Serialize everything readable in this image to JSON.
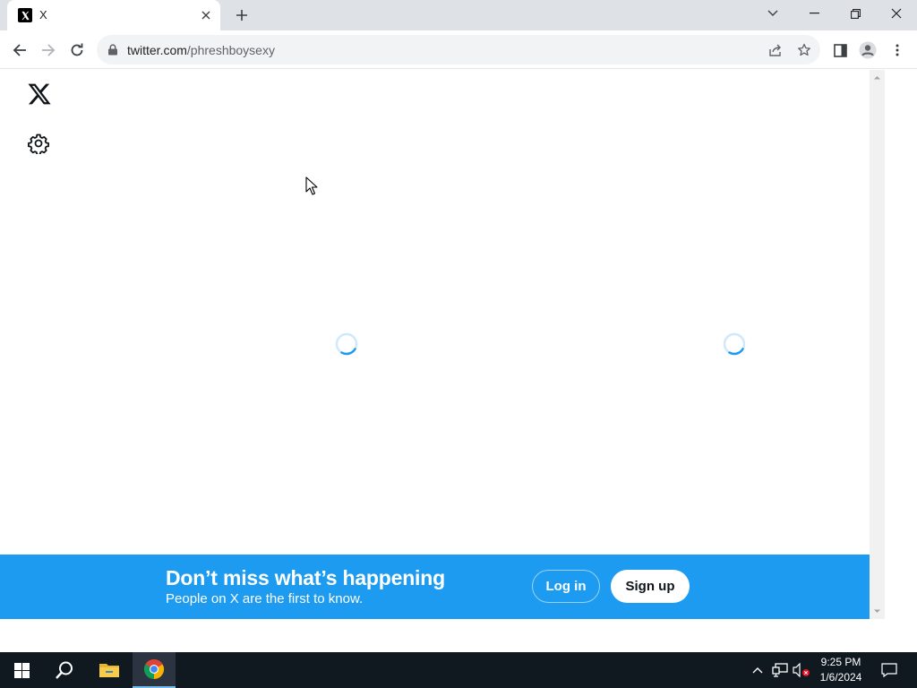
{
  "browser": {
    "tab": {
      "title": "X"
    },
    "address": {
      "host": "twitter.com",
      "path": "/phreshboysexy"
    }
  },
  "page": {
    "banner": {
      "title": "Don’t miss what’s happening",
      "subtitle": "People on X are the first to know.",
      "login_label": "Log in",
      "signup_label": "Sign up"
    }
  },
  "taskbar": {
    "time": "9:25 PM",
    "date": "1/6/2024"
  },
  "colors": {
    "brand_blue": "#1d9bf0",
    "spinner": "#1d9bf0",
    "taskbar": "#101820"
  },
  "icons": {
    "tab_favicon": "x-logo-icon",
    "new_tab": "plus-icon",
    "nav": [
      "back-arrow-icon",
      "forward-arrow-icon",
      "reload-icon"
    ],
    "omnibox": [
      "lock-icon",
      "share-icon",
      "star-icon"
    ],
    "toolbar": [
      "side-panel-icon",
      "profile-icon",
      "kebab-menu-icon"
    ],
    "page": [
      "x-logo-icon",
      "settings-gear-icon"
    ],
    "taskbar": [
      "windows-start-icon",
      "search-icon",
      "file-explorer-icon",
      "chrome-icon"
    ]
  }
}
